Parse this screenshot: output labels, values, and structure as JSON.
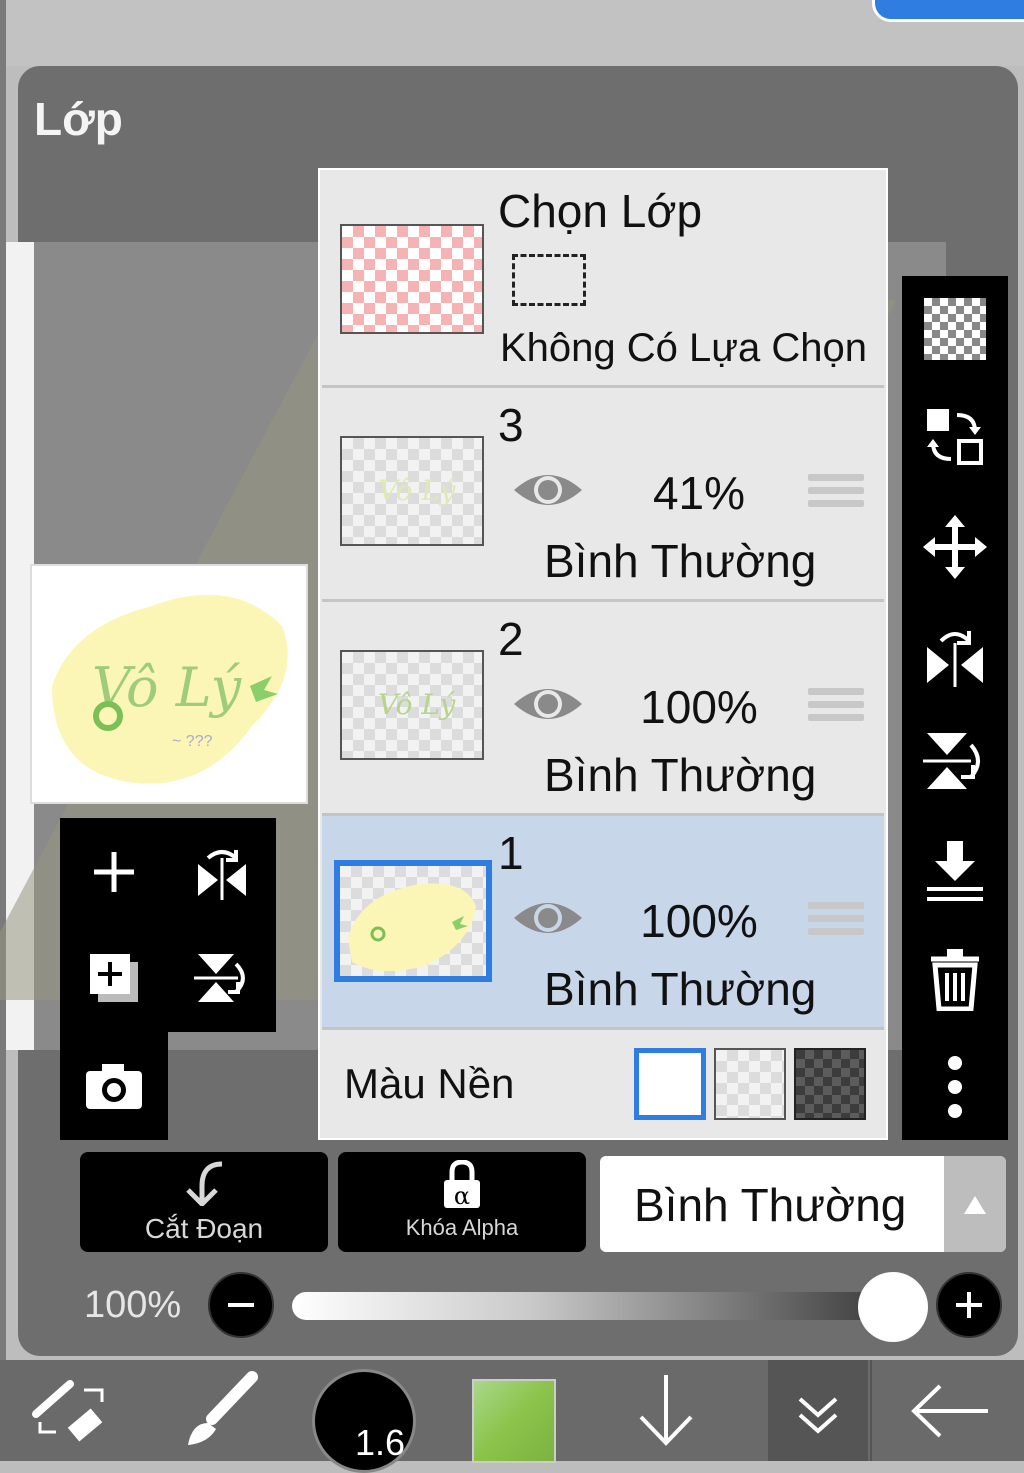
{
  "panel": {
    "title": "Lớp"
  },
  "selection_layer": {
    "title": "Chọn Lớp",
    "status": "Không Có Lựa Chọn"
  },
  "layers": [
    {
      "name": "3",
      "opacity": "41%",
      "blend": "Bình Thường",
      "visible": true,
      "selected": false
    },
    {
      "name": "2",
      "opacity": "100%",
      "blend": "Bình Thường",
      "visible": true,
      "selected": false
    },
    {
      "name": "1",
      "opacity": "100%",
      "blend": "Bình Thường",
      "visible": true,
      "selected": true
    }
  ],
  "background": {
    "label": "Màu Nền",
    "options": [
      "white",
      "transparent",
      "dark-checker"
    ],
    "selected": "white"
  },
  "controls": {
    "clip_label": "Cắt Đoạn",
    "alpha_lock_label": "Khóa Alpha",
    "blend_mode": "Bình Thường",
    "opacity_label": "100%",
    "opacity_value": 1.0
  },
  "toolbar": {
    "brush_size": "1.6",
    "color": "#8bc34a"
  },
  "colors": {
    "selected_row": "#c8d6ea",
    "accent_blue": "#2f7de0",
    "panel_bg": "#6e6e6e"
  }
}
